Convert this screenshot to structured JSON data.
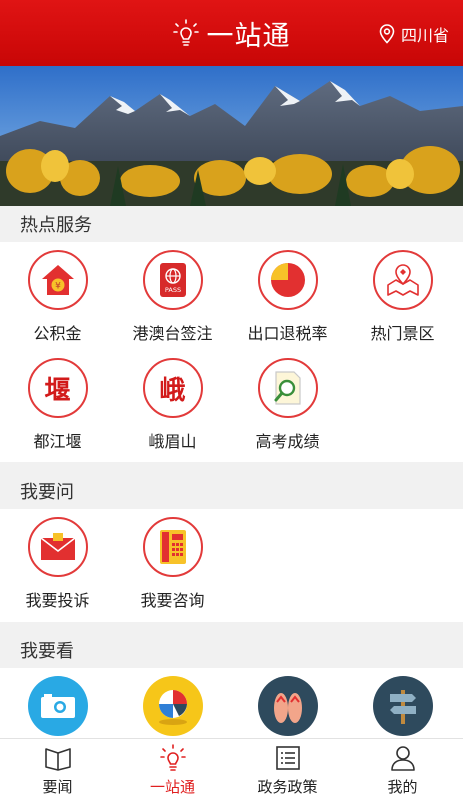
{
  "header": {
    "title": "一站通",
    "location": "四川省"
  },
  "hot": {
    "title": "热点服务",
    "items": [
      {
        "label": "公积金",
        "icon": "house-coin-icon"
      },
      {
        "label": "港澳台签注",
        "icon": "passport-icon",
        "badge": "PASS"
      },
      {
        "label": "出口退税率",
        "icon": "pie-chart-icon"
      },
      {
        "label": "热门景区",
        "icon": "map-location-icon"
      },
      {
        "label": "都江堰",
        "icon": "dujiangyan-icon",
        "char": "堰"
      },
      {
        "label": "峨眉山",
        "icon": "emeishan-icon",
        "char": "峨"
      },
      {
        "label": "高考成绩",
        "icon": "document-search-icon"
      }
    ]
  },
  "ask": {
    "title": "我要问",
    "items": [
      {
        "label": "我要投诉",
        "icon": "envelope-icon"
      },
      {
        "label": "我要咨询",
        "icon": "telephone-icon"
      }
    ]
  },
  "look": {
    "title": "我要看",
    "items": [
      {
        "icon": "camera-icon",
        "color": "#29a9e4"
      },
      {
        "icon": "beach-ball-icon",
        "color": "#f6c619"
      },
      {
        "icon": "flip-flops-icon",
        "color": "#2e4a5d"
      },
      {
        "icon": "signpost-icon",
        "color": "#2e4a5d"
      }
    ]
  },
  "tabs": [
    {
      "label": "要闻",
      "icon": "book-icon"
    },
    {
      "label": "一站通",
      "icon": "lightbulb-icon",
      "active": true
    },
    {
      "label": "政务政策",
      "icon": "list-icon"
    },
    {
      "label": "我的",
      "icon": "user-icon"
    }
  ],
  "colors": {
    "brand": "#d40a0a",
    "accent": "#e23a3a",
    "text": "#222222"
  }
}
